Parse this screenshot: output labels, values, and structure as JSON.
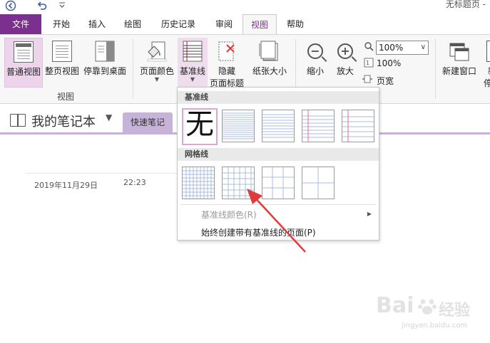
{
  "titlebar": {
    "title": "无标题页 -",
    "icons": [
      "back-icon",
      "undo-icon",
      "customize-icon"
    ]
  },
  "tabs": [
    {
      "label": "文件"
    },
    {
      "label": "开始"
    },
    {
      "label": "插入"
    },
    {
      "label": "绘图"
    },
    {
      "label": "历史记录"
    },
    {
      "label": "审阅"
    },
    {
      "label": "视图"
    },
    {
      "label": "帮助"
    }
  ],
  "ribbon": {
    "normal_view": "普通视图",
    "full_page_view": "整页视图",
    "dock_desktop": "停靠到桌面",
    "group_view": "视图",
    "page_color": "页面颜色",
    "rule_lines": "基准线",
    "hide_title_line1": "隐藏",
    "hide_title_line2": "页面标题",
    "paper_size": "纸张大小",
    "zoom_out": "缩小",
    "zoom_in": "放大",
    "zoom_value": "100%",
    "zoom_100": "100%",
    "page_width": "页宽",
    "new_window": "新建窗口",
    "cut_label": "新",
    "cut_label2": "停"
  },
  "notebook": {
    "title": "我的笔记本",
    "section": "快速笔记"
  },
  "page": {
    "date": "2019年11月29日",
    "time": "22:23"
  },
  "dropdown": {
    "rule_header": "基准线",
    "grid_header": "网格线",
    "none_glyph": "无",
    "rule_color": "基准线颜色(R)",
    "always_create": "始终创建带有基准线的页面(P)"
  },
  "watermark": {
    "brand": "Bai",
    "brand2": "经验",
    "site": "jingyan.baidu.com"
  },
  "colors": {
    "accent": "#7b2f8f",
    "section_tab": "#c7b2d8",
    "selected_button": "#ecd4ea",
    "arrow": "#e03a3a"
  }
}
